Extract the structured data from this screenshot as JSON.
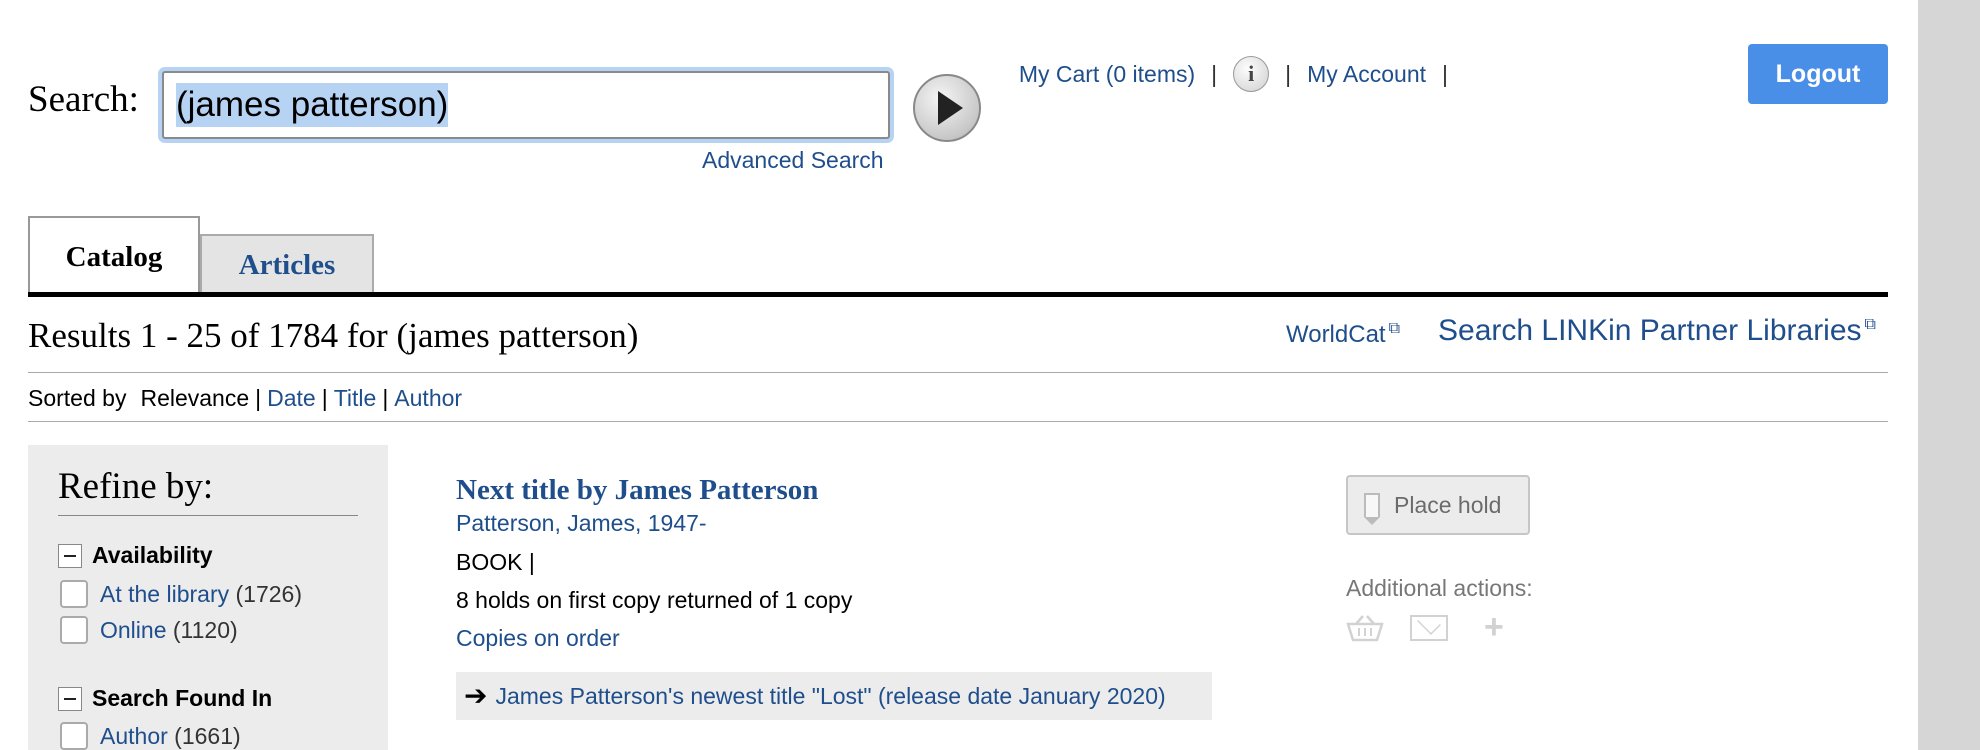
{
  "search": {
    "label": "Search:",
    "value": "(james patterson)",
    "advanced_link": "Advanced Search"
  },
  "topnav": {
    "cart": "My Cart (0 items)",
    "sep": "|",
    "account": "My Account",
    "logout": "Logout"
  },
  "tabs": {
    "catalog": "Catalog",
    "articles": "Articles"
  },
  "results": {
    "heading": "Results 1 - 25 of 1784 for (james patterson)",
    "worldcat": "WorldCat",
    "partner": "Search LINKin Partner Libraries"
  },
  "sort": {
    "label": "Sorted by",
    "current": "Relevance",
    "sep": "|",
    "options": [
      "Date",
      "Title",
      "Author"
    ]
  },
  "refine": {
    "title": "Refine by:",
    "facets": [
      {
        "heading": "Availability",
        "items": [
          {
            "label": "At the library",
            "count": "(1726)"
          },
          {
            "label": "Online",
            "count": "(1120)"
          }
        ]
      },
      {
        "heading": "Search Found In",
        "items": [
          {
            "label": "Author",
            "count": "(1661)"
          }
        ]
      }
    ]
  },
  "result": {
    "title": "Next title by James Patterson",
    "author": "Patterson, James, 1947-",
    "format": "BOOK  |",
    "holds": "8 holds on first copy returned of 1 copy",
    "order": "Copies on order",
    "note": "James Patterson's newest title \"Lost\" (release date January 2020)",
    "place_hold": "Place hold",
    "additional_actions": "Additional actions:"
  },
  "colors": {
    "link": "#1f4e8c",
    "logout_bg": "#4a8fe7",
    "sidebar_bg": "#ececec"
  }
}
